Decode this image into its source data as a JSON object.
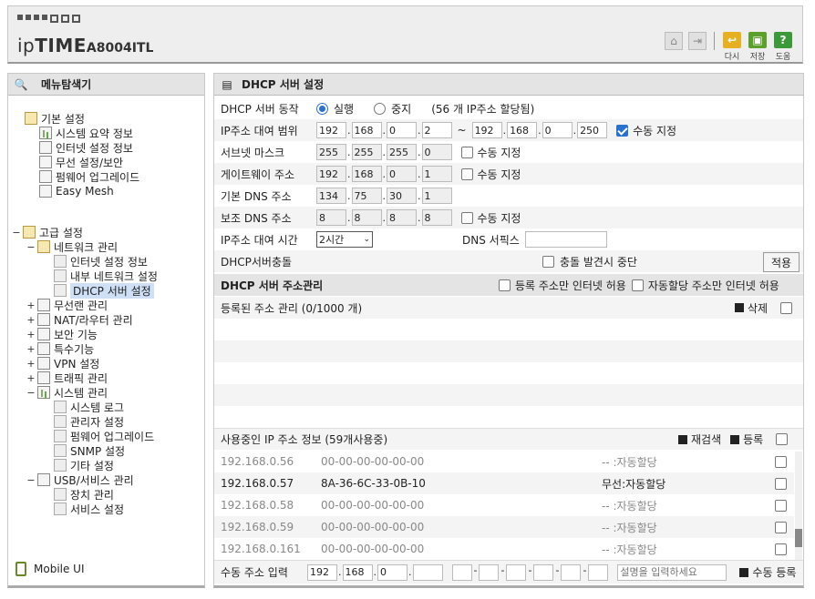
{
  "header": {
    "brand_ip": "ip",
    "brand_time": "TIME",
    "model": "A8004ITL",
    "buttons": [
      {
        "label": "다시",
        "icon": "undo-icon",
        "color": "#e6b020"
      },
      {
        "label": "저장",
        "icon": "save-icon",
        "color": "#5aa02a"
      },
      {
        "label": "도움",
        "icon": "help-icon",
        "color": "#3a9a3a",
        "glyph": "?"
      }
    ]
  },
  "sidebar": {
    "title": "메뉴탐색기",
    "basic": {
      "label": "기본 설정",
      "items": [
        "시스템 요약 정보",
        "인터넷 설정 정보",
        "무선 설정/보안",
        "펌웨어 업그레이드",
        "Easy Mesh"
      ]
    },
    "advanced": {
      "label": "고급 설정",
      "network": {
        "label": "네트워크 관리",
        "items": [
          "인터넷 설정 정보",
          "내부 네트워크 설정",
          "DHCP 서버 설정"
        ]
      },
      "groups": [
        "무선랜 관리",
        "NAT/라우터 관리",
        "보안 기능",
        "특수기능",
        "VPN 설정",
        "트래픽 관리"
      ],
      "system": {
        "label": "시스템 관리",
        "items": [
          "시스템 로그",
          "관리자 설정",
          "펌웨어 업그레이드",
          "SNMP 설정",
          "기타 설정"
        ]
      },
      "usb": {
        "label": "USB/서비스 관리",
        "items": [
          "장치 관리",
          "서비스 설정"
        ]
      }
    },
    "mobile": "Mobile UI"
  },
  "main": {
    "title": "DHCP 서버 설정",
    "server_action": {
      "label": "DHCP 서버 동작",
      "on": "실행",
      "off": "중지",
      "note": "(56 개 IP주소 할당됨)"
    },
    "range": {
      "label": "IP주소 대여 범위",
      "start": [
        "192",
        "168",
        "0",
        "2"
      ],
      "tilde": "~",
      "end": [
        "192",
        "168",
        "0",
        "250"
      ],
      "manual": "수동 지정"
    },
    "subnet": {
      "label": "서브넷 마스크",
      "value": [
        "255",
        "255",
        "255",
        "0"
      ],
      "manual": "수동 지정"
    },
    "gateway": {
      "label": "게이트웨이 주소",
      "value": [
        "192",
        "168",
        "0",
        "1"
      ],
      "manual": "수동 지정"
    },
    "dns1": {
      "label": "기본 DNS 주소",
      "value": [
        "134",
        "75",
        "30",
        "1"
      ]
    },
    "dns2": {
      "label": "보조 DNS 주소",
      "value": [
        "8",
        "8",
        "8",
        "8"
      ],
      "manual": "수동 지정"
    },
    "lease": {
      "label": "IP주소 대여 시간",
      "value": "2시간",
      "dns_suffix_label": "DNS 서픽스",
      "dns_suffix_value": ""
    },
    "conflict": {
      "label": "DHCP서버충돌",
      "stop": "충돌 발견시 중단",
      "apply": "적용"
    },
    "addr_mgmt": {
      "title": "DHCP 서버 주소관리",
      "opt1": "등록 주소만 인터넷 허용",
      "opt2": "자동할당 주소만 인터넷 허용"
    },
    "registered": {
      "label": "등록된 주소 관리 (0/1000 개)",
      "delete": "삭제"
    },
    "in_use": {
      "label": "사용중인 IP 주소 정보 (59개사용중)",
      "rescan": "재검색",
      "register": "등록",
      "rows": [
        {
          "ip": "192.168.0.56",
          "mac": "00-00-00-00-00-00",
          "type": "-- :자동할당",
          "dim": true
        },
        {
          "ip": "192.168.0.57",
          "mac": "8A-36-6C-33-0B-10",
          "type": "무선:자동할당",
          "dim": false
        },
        {
          "ip": "192.168.0.58",
          "mac": "00-00-00-00-00-00",
          "type": "-- :자동할당",
          "dim": true
        },
        {
          "ip": "192.168.0.59",
          "mac": "00-00-00-00-00-00",
          "type": "-- :자동할당",
          "dim": true
        },
        {
          "ip": "192.168.0.161",
          "mac": "00-00-00-00-00-00",
          "type": "-- :자동할당",
          "dim": true
        }
      ]
    },
    "manual_entry": {
      "label": "수동 주소 입력",
      "ip": [
        "192",
        "168",
        "0",
        ""
      ],
      "desc_placeholder": "설명을 입력하세요",
      "register": "수동 등록"
    }
  }
}
